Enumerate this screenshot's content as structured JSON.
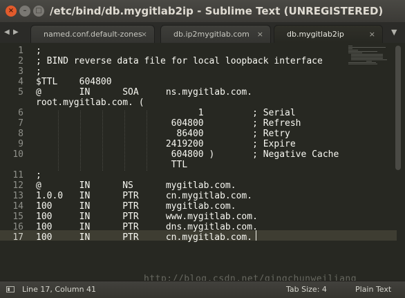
{
  "window": {
    "title": "/etc/bind/db.mygitlab2ip - Sublime Text (UNREGISTERED)"
  },
  "window_controls": {
    "close": "×",
    "minimize": "–",
    "maximize": "□"
  },
  "tab_nav": {
    "prev": "◀",
    "next": "▶",
    "menu": "▼"
  },
  "tabs": [
    {
      "label": "named.conf.default-zones",
      "close": "×"
    },
    {
      "label": "db.ip2mygitlab.com",
      "close": "×"
    },
    {
      "label": "db.mygitlab2ip",
      "close": "×"
    }
  ],
  "editor": {
    "line_numbers": [
      "1",
      "2",
      "3",
      "4",
      "5",
      "",
      "6",
      "7",
      "8",
      "9",
      "10",
      "",
      "11",
      "12",
      "13",
      "14",
      "15",
      "16",
      "17"
    ],
    "current_line": "17",
    "lines": [
      ";",
      "; BIND reverse data file for local loopback interface",
      ";",
      "$TTL    604800",
      "@       IN      SOA     ns.mygitlab.com.",
      "root.mygitlab.com. (",
      "                              1         ; Serial",
      "                         604800         ; Refresh",
      "                          86400         ; Retry",
      "                        2419200         ; Expire",
      "                         604800 )       ; Negative Cache",
      "                         TTL",
      ";",
      "@       IN      NS      mygitlab.com.",
      "1.0.0   IN      PTR     cn.mygitlab.com.",
      "100     IN      PTR     mygitlab.com.",
      "100     IN      PTR     www.mygitlab.com.",
      "100     IN      PTR     dns.mygitlab.com.",
      "100     IN      PTR     cn.mygitlab.com."
    ]
  },
  "status": {
    "position": "Line 17, Column 41",
    "tab_size": "Tab Size: 4",
    "syntax": "Plain Text"
  },
  "watermark": "http://blog.csdn.net/qingchunweiliang"
}
